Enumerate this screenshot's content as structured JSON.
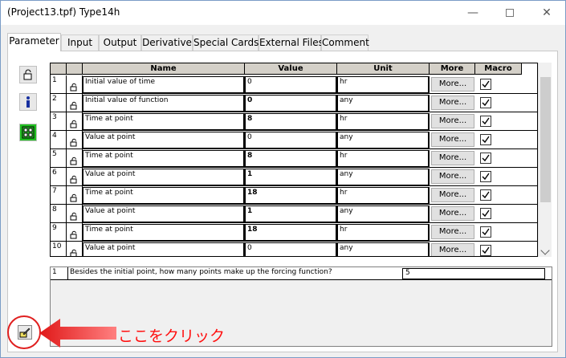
{
  "window": {
    "title": "(Project13.tpf) Type14h"
  },
  "tabs": [
    {
      "label": "Parameter",
      "active": true
    },
    {
      "label": "Input"
    },
    {
      "label": "Output"
    },
    {
      "label": "Derivative"
    },
    {
      "label": "Special Cards"
    },
    {
      "label": "External Files"
    },
    {
      "label": "Comment"
    }
  ],
  "grid": {
    "headers": {
      "name": "Name",
      "value": "Value",
      "unit": "Unit",
      "more": "More",
      "macro": "Macro"
    },
    "more_label": "More...",
    "rows": [
      {
        "num": "1",
        "name": "Initial value of time",
        "value": "0",
        "unit": "hr",
        "bold": false
      },
      {
        "num": "2",
        "name": "Initial value of function",
        "value": "0",
        "unit": "any",
        "bold": true
      },
      {
        "num": "3",
        "name": "Time at point",
        "value": "8",
        "unit": "hr",
        "bold": true
      },
      {
        "num": "4",
        "name": "Value at point",
        "value": "0",
        "unit": "any",
        "bold": false
      },
      {
        "num": "5",
        "name": "Time at point",
        "value": "8",
        "unit": "hr",
        "bold": true
      },
      {
        "num": "6",
        "name": "Value at point",
        "value": "1",
        "unit": "any",
        "bold": true
      },
      {
        "num": "7",
        "name": "Time at point",
        "value": "18",
        "unit": "hr",
        "bold": true
      },
      {
        "num": "8",
        "name": "Value at point",
        "value": "1",
        "unit": "any",
        "bold": true
      },
      {
        "num": "9",
        "name": "Time at point",
        "value": "18",
        "unit": "hr",
        "bold": true
      },
      {
        "num": "10",
        "name": "Value at point",
        "value": "0",
        "unit": "any",
        "bold": false
      }
    ]
  },
  "question": {
    "num": "1",
    "text": "Besides the initial point, how many points make up the forcing function?",
    "value": "5"
  },
  "annotation": {
    "label": "ここをクリック",
    "color": "#ff1010"
  },
  "icons": {
    "side1": "unlock-icon",
    "side2": "info-icon",
    "side3": "grid-icon",
    "edit": "edit-icon"
  }
}
